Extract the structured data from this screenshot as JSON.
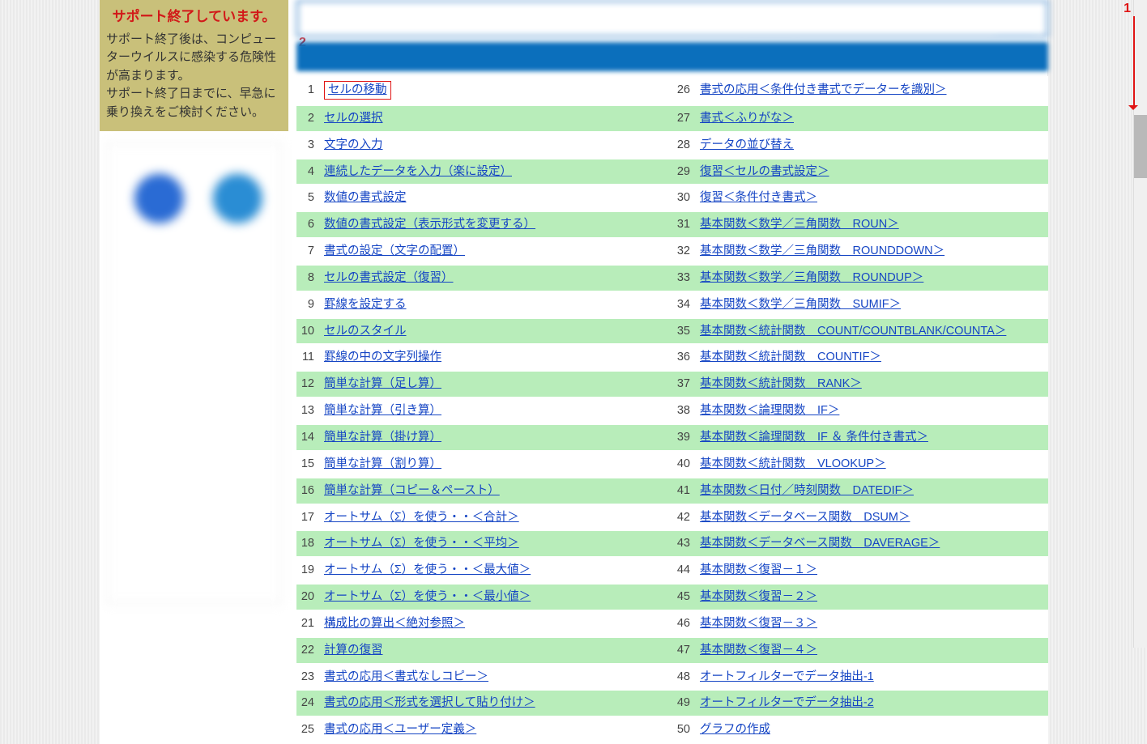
{
  "marker_1": "1",
  "marker_2": "2",
  "warn": {
    "title": "サポート終了しています。",
    "body": "サポート終了後は、コンピューターウイルスに感染する危険性が高まります。\nサポート終了日までに、早急に乗り換えをご検討ください。"
  },
  "left": [
    {
      "n": "1",
      "t": "セルの移動",
      "hl": true
    },
    {
      "n": "2",
      "t": "セルの選択"
    },
    {
      "n": "3",
      "t": "文字の入力"
    },
    {
      "n": "4",
      "t": "連続したデータを入力（楽に設定）"
    },
    {
      "n": "5",
      "t": "数値の書式設定"
    },
    {
      "n": "6",
      "t": "数値の書式設定（表示形式を変更する）"
    },
    {
      "n": "7",
      "t": "書式の設定（文字の配置）"
    },
    {
      "n": "8",
      "t": "セルの書式設定（復習）"
    },
    {
      "n": "9",
      "t": "罫線を設定する"
    },
    {
      "n": "10",
      "t": "セルのスタイル"
    },
    {
      "n": "11",
      "t": "罫線の中の文字列操作"
    },
    {
      "n": "12",
      "t": "簡単な計算（足し算）"
    },
    {
      "n": "13",
      "t": "簡単な計算（引き算）"
    },
    {
      "n": "14",
      "t": "簡単な計算（掛け算）"
    },
    {
      "n": "15",
      "t": "簡単な計算（割り算）"
    },
    {
      "n": "16",
      "t": "簡単な計算（コピー＆ペースト）"
    },
    {
      "n": "17",
      "t": "オートサム（Σ）を使う・・＜合計＞"
    },
    {
      "n": "18",
      "t": "オートサム（Σ）を使う・・＜平均＞"
    },
    {
      "n": "19",
      "t": "オートサム（Σ）を使う・・＜最大値＞"
    },
    {
      "n": "20",
      "t": "オートサム（Σ）を使う・・＜最小値＞"
    },
    {
      "n": "21",
      "t": "構成比の算出＜絶対参照＞"
    },
    {
      "n": "22",
      "t": "計算の復習"
    },
    {
      "n": "23",
      "t": "書式の応用＜書式なしコピー＞"
    },
    {
      "n": "24",
      "t": "書式の応用＜形式を選択して貼り付け＞"
    },
    {
      "n": "25",
      "t": "書式の応用＜ユーザー定義＞"
    }
  ],
  "right": [
    {
      "n": "26",
      "t": "書式の応用＜条件付き書式でデーターを識別＞"
    },
    {
      "n": "27",
      "t": "書式＜ふりがな＞"
    },
    {
      "n": "28",
      "t": "データの並び替え"
    },
    {
      "n": "29",
      "t": "復習＜セルの書式設定＞"
    },
    {
      "n": "30",
      "t": "復習＜条件付き書式＞"
    },
    {
      "n": "31",
      "t": "基本関数＜数学／三角関数　ROUN＞"
    },
    {
      "n": "32",
      "t": "基本関数＜数学／三角関数　ROUNDDOWN＞"
    },
    {
      "n": "33",
      "t": "基本関数＜数学／三角関数　ROUNDUP＞"
    },
    {
      "n": "34",
      "t": "基本関数＜数学／三角関数　SUMIF＞"
    },
    {
      "n": "35",
      "t": "基本関数＜統計関数　COUNT/COUNTBLANK/COUNTA＞"
    },
    {
      "n": "36",
      "t": "基本関数＜統計関数　COUNTIF＞"
    },
    {
      "n": "37",
      "t": "基本関数＜統計関数　RANK＞"
    },
    {
      "n": "38",
      "t": "基本関数＜論理関数　IF＞"
    },
    {
      "n": "39",
      "t": "基本関数＜論理関数　IF ＆ 条件付き書式＞"
    },
    {
      "n": "40",
      "t": "基本関数＜統計関数　VLOOKUP＞"
    },
    {
      "n": "41",
      "t": "基本関数＜日付／時刻関数　DATEDIF＞"
    },
    {
      "n": "42",
      "t": "基本関数＜データベース関数　DSUM＞"
    },
    {
      "n": "43",
      "t": "基本関数＜データベース関数　DAVERAGE＞"
    },
    {
      "n": "44",
      "t": "基本関数＜復習－１＞"
    },
    {
      "n": "45",
      "t": "基本関数＜復習－２＞"
    },
    {
      "n": "46",
      "t": "基本関数＜復習－３＞"
    },
    {
      "n": "47",
      "t": "基本関数＜復習－４＞"
    },
    {
      "n": "48",
      "t": "オートフィルターでデータ抽出-1"
    },
    {
      "n": "49",
      "t": "オートフィルターでデータ抽出-2"
    },
    {
      "n": "50",
      "t": "グラフの作成"
    }
  ]
}
